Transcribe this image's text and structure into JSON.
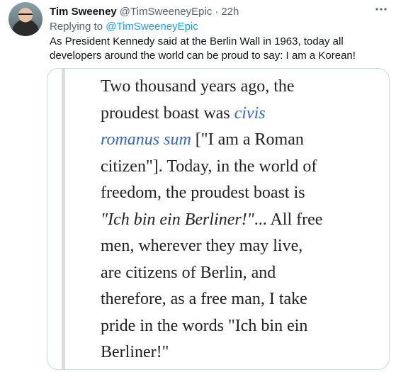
{
  "tweet": {
    "author_name": "Tim Sweeney",
    "author_handle": "@TimSweeneyEpic",
    "separator": "·",
    "time": "22h",
    "more_icon": "ellipsis-icon",
    "replying_prefix": "Replying to",
    "replying_handle": "@TimSweeneyEpic",
    "text": "As President Kennedy said at the Berlin Wall in 1963, today all developers around the world can be proud to say: I am a Korean!"
  },
  "image": {
    "lines": [
      {
        "parts": [
          {
            "t": "Two thousand years ago, the",
            "s": "normal"
          }
        ]
      },
      {
        "parts": [
          {
            "t": "proudest boast was ",
            "s": "normal"
          },
          {
            "t": "civis",
            "s": "link"
          }
        ]
      },
      {
        "parts": [
          {
            "t": "romanus sum",
            "s": "link"
          },
          {
            "t": " [\"I am a Roman",
            "s": "normal"
          }
        ]
      },
      {
        "parts": [
          {
            "t": "citizen\"]. Today, in the world of",
            "s": "normal"
          }
        ]
      },
      {
        "parts": [
          {
            "t": "freedom, the proudest boast is",
            "s": "normal"
          }
        ]
      },
      {
        "parts": [
          {
            "t": "\"Ich bin ein Berliner!\"",
            "s": "italic"
          },
          {
            "t": "... All free",
            "s": "normal"
          }
        ]
      },
      {
        "parts": [
          {
            "t": "men, wherever they may live,",
            "s": "normal"
          }
        ]
      },
      {
        "parts": [
          {
            "t": "are citizens of Berlin, and",
            "s": "normal"
          }
        ]
      },
      {
        "parts": [
          {
            "t": "therefore, as a free man, I take",
            "s": "normal"
          }
        ]
      },
      {
        "parts": [
          {
            "t": "pride in the words \"Ich bin ein",
            "s": "normal"
          }
        ]
      },
      {
        "parts": [
          {
            "t": "Berliner!\"",
            "s": "normal"
          }
        ]
      }
    ]
  }
}
